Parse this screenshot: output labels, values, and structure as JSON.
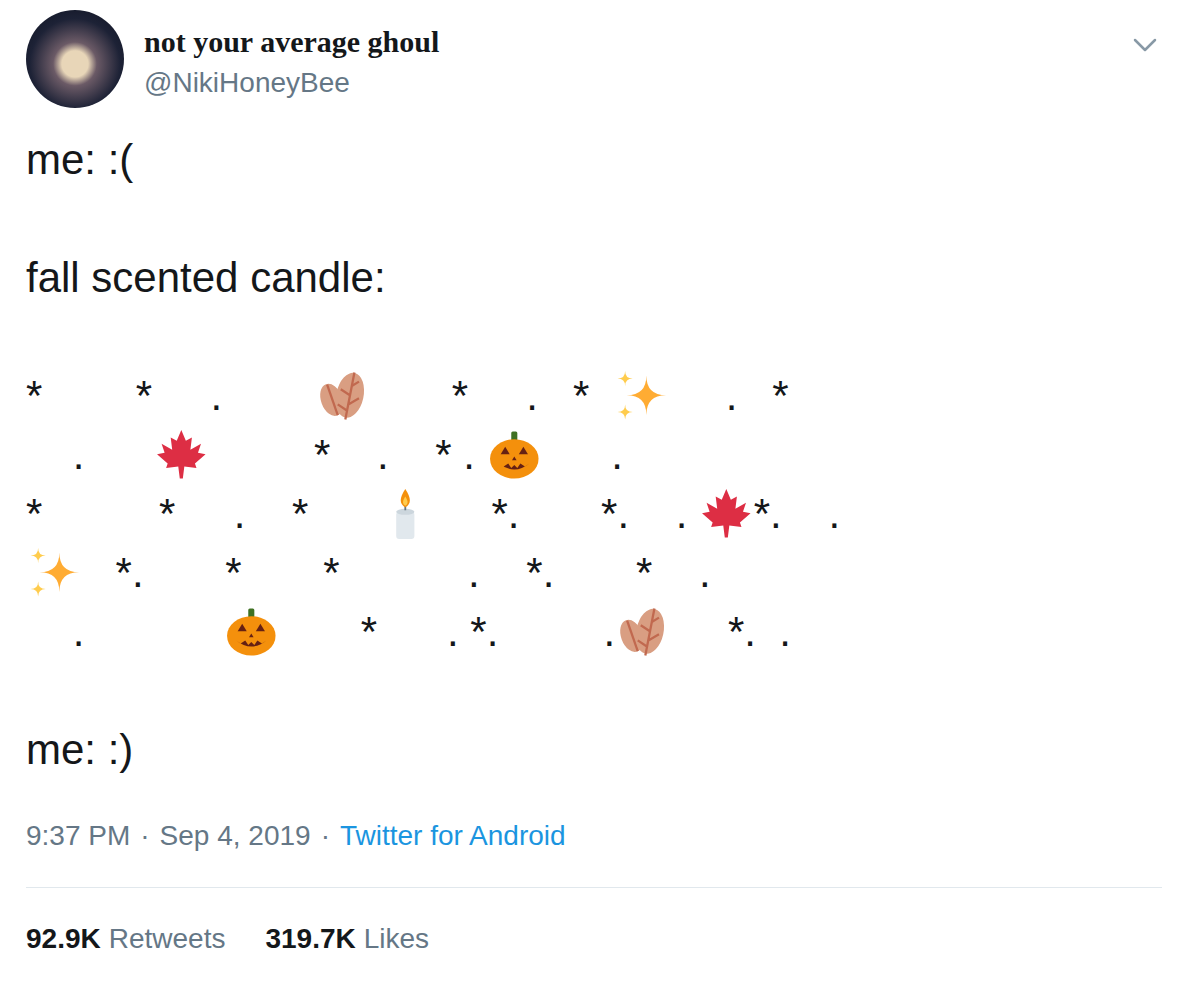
{
  "tweet": {
    "author": {
      "display_name": "not your average ghoul",
      "handle": "@NikiHoneyBee"
    },
    "body_lines": [
      "me: :(",
      "",
      "fall scented candle:",
      "",
      "*        *     .        🍂       *     .   *  ✨     .   *",
      "    .      🍁         *    .    * . 🎃      .",
      "*          *     .    *      🕯     *.       *.    . 🍁*.    .",
      "✨   *.       *       *           .    *.       *    .",
      "    .            🎃       *      . *.         .🍂     *.  .",
      "",
      "me: :)"
    ],
    "meta": {
      "time": "9:37 PM",
      "separator": "·",
      "date": "Sep 4, 2019",
      "source": "Twitter for Android"
    },
    "stats": [
      {
        "count": "92.9K",
        "label": "Retweets"
      },
      {
        "count": "319.7K",
        "label": "Likes"
      }
    ]
  }
}
